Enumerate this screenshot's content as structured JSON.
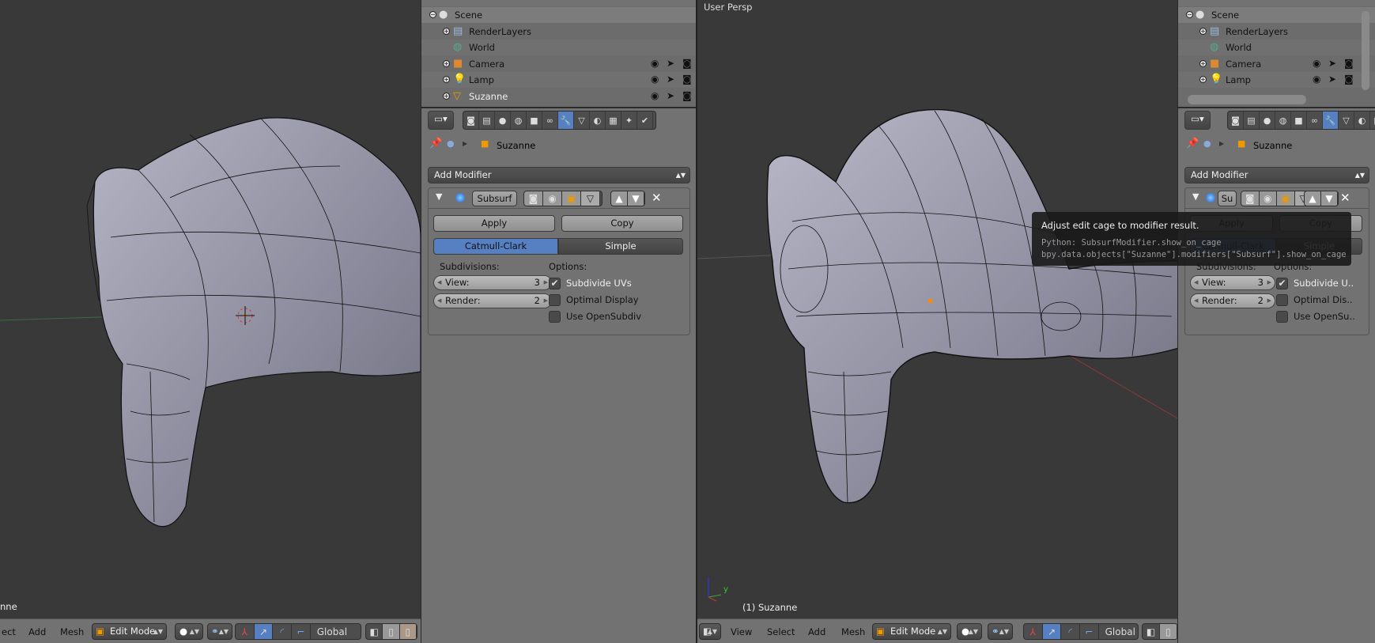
{
  "left_viewport": {
    "object_label": "nne",
    "menu": [
      "ect",
      "Add",
      "Mesh"
    ],
    "mode": "Edit Mode",
    "orientation": "Global"
  },
  "right_viewport": {
    "view_label": "User Persp",
    "object_label": "(1) Suzanne",
    "axis_y": "y",
    "menu": [
      "View",
      "Select",
      "Add",
      "Mesh"
    ],
    "mode": "Edit Mode",
    "orientation": "Global"
  },
  "left_panel": {
    "outliner": [
      {
        "name": "Scene",
        "icon": "scene-icon"
      },
      {
        "name": "RenderLayers",
        "icon": "renderlayers-icon"
      },
      {
        "name": "World",
        "icon": "world-icon"
      },
      {
        "name": "Camera",
        "icon": "camera-object-icon"
      },
      {
        "name": "Lamp",
        "icon": "lamp-icon"
      },
      {
        "name": "Suzanne",
        "icon": "mesh-object-icon"
      }
    ],
    "tabs": [
      "render",
      "render-layers",
      "scene",
      "world",
      "object",
      "constraints",
      "modifiers",
      "data",
      "material",
      "texture",
      "particles",
      "physics"
    ],
    "active_tab": "modifiers",
    "breadcrumb": "Suzanne",
    "add_modifier": "Add Modifier",
    "modifier": {
      "name": "Subsurf",
      "apply": "Apply",
      "copy": "Copy",
      "type_options": [
        "Catmull-Clark",
        "Simple"
      ],
      "selected_type": "Catmull-Clark",
      "subdivisions_label": "Subdivisions:",
      "options_label": "Options:",
      "view_label": "View:",
      "view_value": "3",
      "render_label": "Render:",
      "render_value": "2",
      "checks": [
        {
          "label": "Subdivide UVs",
          "checked": true
        },
        {
          "label": "Optimal Display",
          "checked": false
        },
        {
          "label": "Use OpenSubdiv",
          "checked": false
        }
      ]
    }
  },
  "right_panel": {
    "outliner": [
      {
        "name": "Scene"
      },
      {
        "name": "RenderLayers"
      },
      {
        "name": "World"
      },
      {
        "name": "Camera"
      },
      {
        "name": "Lamp"
      }
    ],
    "breadcrumb": "Suzanne",
    "add_modifier": "Add Modifier",
    "modifier": {
      "name": "Su",
      "apply": "Apply",
      "copy": "Copy",
      "type_options": [
        "Catmull-Clark",
        "Simple"
      ],
      "subdivisions_label": "Subdivisions:",
      "options_label": "Options:",
      "view_label": "View:",
      "view_value": "3",
      "render_label": "Render:",
      "render_value": "2",
      "checks": [
        {
          "label": "Subdivide U..",
          "checked": true
        },
        {
          "label": "Optimal Dis..",
          "checked": false
        },
        {
          "label": "Use OpenSu..",
          "checked": false
        }
      ]
    }
  },
  "tooltip": {
    "title": "Adjust edit cage to modifier result.",
    "python": "Python: SubsurfModifier.show_on_cage",
    "path": "bpy.data.objects[\"Suzanne\"].modifiers[\"Subsurf\"].show_on_cage"
  },
  "colors": {
    "accent": "#5680c2",
    "viewport_bg": "#393939",
    "panel_bg": "#727272"
  }
}
